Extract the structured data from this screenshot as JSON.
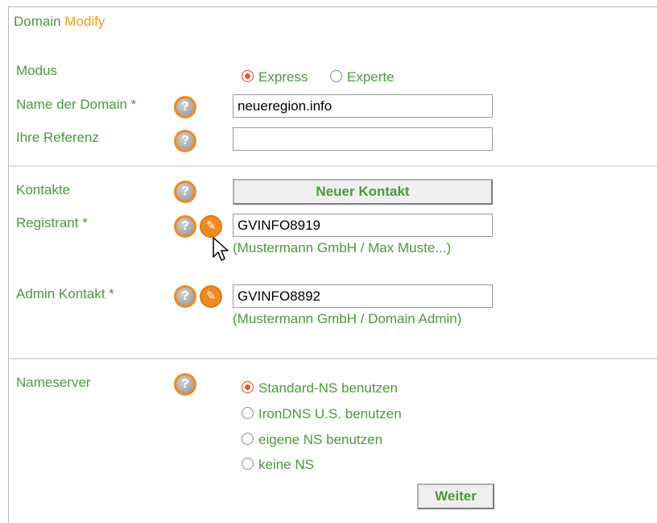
{
  "header": {
    "title_a": "Domain",
    "title_b": "Modify"
  },
  "form": {
    "modus": {
      "label": "Modus",
      "options": [
        {
          "label": "Express",
          "selected": true
        },
        {
          "label": "Experte",
          "selected": false
        }
      ]
    },
    "domain_name": {
      "label": "Name der Domain *",
      "value": "neueregion.info"
    },
    "reference": {
      "label": "Ihre Referenz",
      "value": ""
    },
    "contacts": {
      "label": "Kontakte",
      "new_contact_button": "Neuer Kontakt"
    },
    "registrant": {
      "label": "Registrant *",
      "value": "GVINFO8919",
      "description": "(Mustermann GmbH / Max Muste...)"
    },
    "admin_contact": {
      "label": "Admin Kontakt *",
      "value": "GVINFO8892",
      "description": "(Mustermann GmbH / Domain Admin)"
    },
    "nameserver": {
      "label": "Nameserver",
      "options": [
        {
          "label": "Standard-NS benutzen",
          "selected": true
        },
        {
          "label": "IronDNS U.S. benutzen",
          "selected": false
        },
        {
          "label": "eigene NS benutzen",
          "selected": false
        },
        {
          "label": "keine NS",
          "selected": false
        }
      ]
    },
    "submit_label": "Weiter"
  },
  "icons": {
    "help": "help-icon",
    "edit": "edit-icon"
  },
  "colors": {
    "label_green": "#4a9a3a",
    "accent_orange": "#f39a1e",
    "icon_orange": "#f08a24"
  }
}
